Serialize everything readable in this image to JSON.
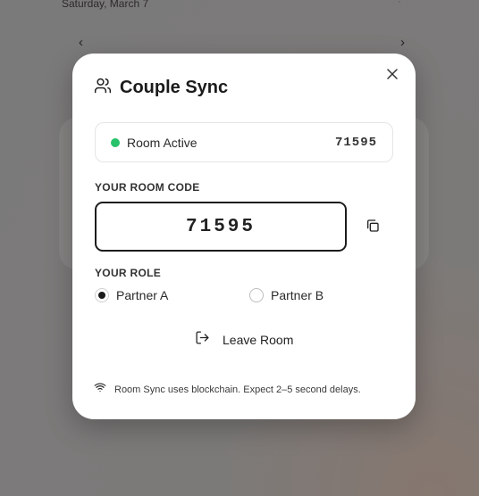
{
  "background": {
    "date": "Saturday, March 7",
    "dots": "·",
    "prev_icon": "‹",
    "next_icon": "›"
  },
  "modal": {
    "title": "Couple Sync",
    "title_icon": "users-icon",
    "close_icon": "close-icon",
    "status": {
      "text": "Room Active",
      "code": "71595",
      "dot_color": "#27c26a"
    },
    "room_code_label": "YOUR ROOM CODE",
    "room_code": "71595",
    "copy_icon": "copy-icon",
    "role_label": "YOUR ROLE",
    "roles": [
      {
        "label": "Partner A",
        "selected": true
      },
      {
        "label": "Partner B",
        "selected": false
      }
    ],
    "leave_label": "Leave Room",
    "leave_icon": "logout-icon",
    "footer_icon": "wifi-icon",
    "footer_text": "Room Sync uses blockchain. Expect 2–5 second delays."
  }
}
